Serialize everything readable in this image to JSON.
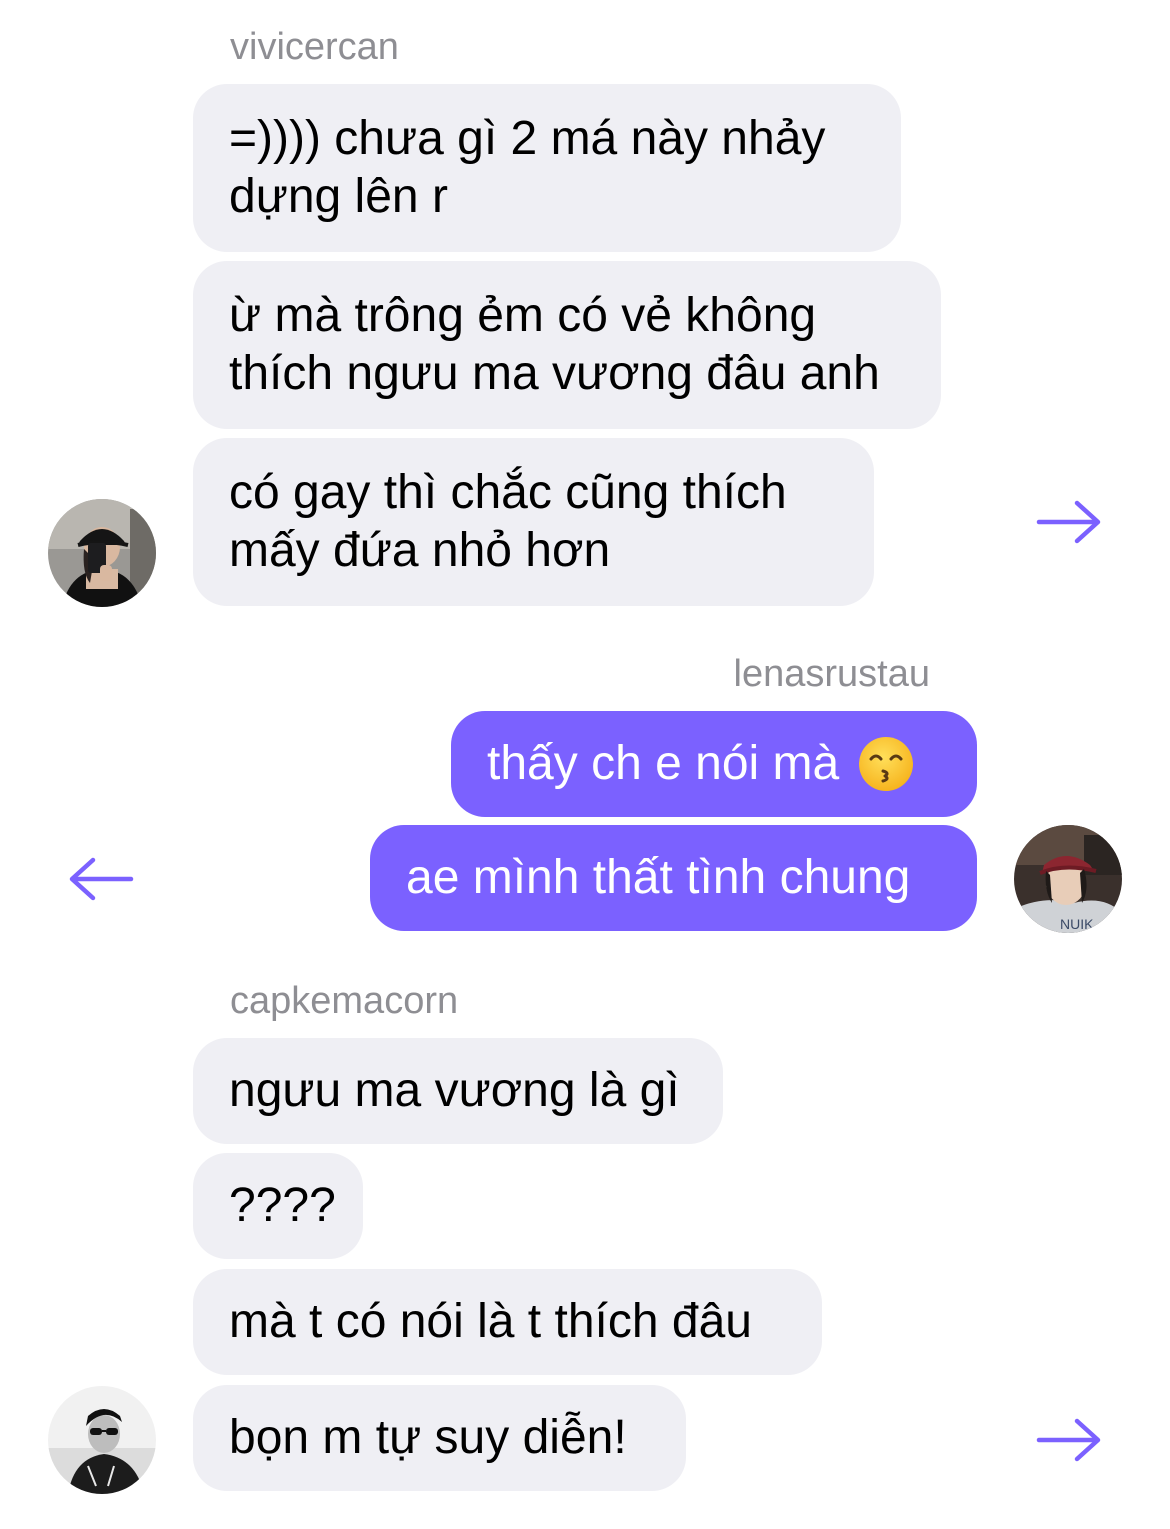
{
  "accent_color": "#7b61ff",
  "incoming_bubble_color": "#efeff4",
  "groups": [
    {
      "sender": "vivicercan",
      "direction": "incoming",
      "avatar": "avatar-photo-woman-dark-cap",
      "forward_icon": "arrow-right-icon",
      "messages": [
        "=)))) chưa gì 2 má này nhảy dựng lên r",
        "ừ mà trông ẻm có vẻ không thích ngưu ma vương đâu anh",
        "có gay thì chắc cũng thích mấy đứa nhỏ hơn"
      ]
    },
    {
      "sender": "lenasrustau",
      "direction": "outgoing",
      "avatar": "avatar-photo-red-cap",
      "forward_icon": "arrow-left-icon",
      "messages": [
        "thấy ch e nói mà",
        "ae mình thất tình chung"
      ],
      "emoji": "kissing-face-smiling-eyes-emoji"
    },
    {
      "sender": "capkemacorn",
      "direction": "incoming",
      "avatar": "avatar-photo-sunglasses-bw",
      "forward_icon": "arrow-right-icon",
      "messages": [
        "ngưu ma vương là gì",
        "????",
        "mà t có nói là t thích đâu",
        "bọn m tự suy diễn!"
      ]
    }
  ]
}
